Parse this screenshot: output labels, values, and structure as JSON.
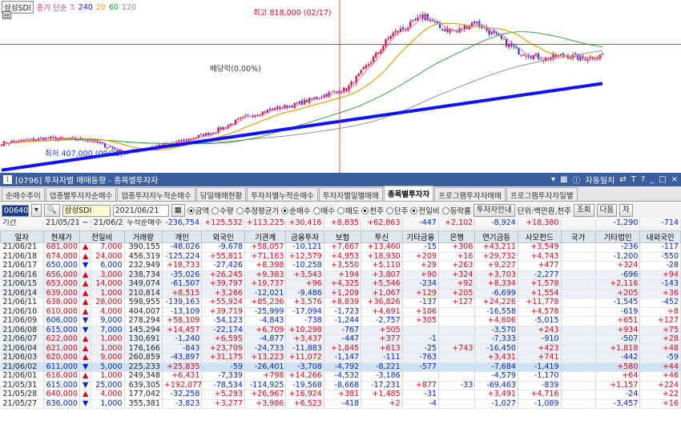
{
  "chart": {
    "legend_stock": "삼성SDI",
    "legend_ma_label": "종가 단순",
    "legend_ma": [
      {
        "period": "5",
        "color": "#ff5aaa"
      },
      {
        "period": "240",
        "color": "#1010ff"
      },
      {
        "period": "20",
        "color": "#e1a000"
      },
      {
        "period": "60",
        "color": "#1b9f2b"
      },
      {
        "period": "120",
        "color": "#888888"
      }
    ],
    "high_label": "최고 818,000 (02/17)",
    "low_label": "최저 407,000 (09/25)",
    "div_label": "배당락(0.00%)",
    "colors": {
      "up": "#e4002a",
      "down": "#1a3cf0",
      "ma5": "#ff5aaa",
      "ma20": "#e1a000",
      "ma60": "#1b9f2b",
      "ma120": "#888888",
      "ma240": "#1010ff"
    }
  },
  "window": {
    "title": "[0796] 투자자별 매매동향 - 종목별투자자",
    "hint": "자동일치",
    "btns": [
      "▾",
      "?",
      "_",
      "□",
      "×"
    ]
  },
  "tabs": [
    "순매수추이",
    "업종별투자자순매수",
    "업종투자자누적순매수",
    "당일매매현황",
    "투자자별누적순매수",
    "투자자별일별매매",
    "종목별투자자",
    "프로그램투자자매매",
    "프로그램투자자일별"
  ],
  "active_tab": 6,
  "controls": {
    "code": "006400",
    "stock_name": "삼성SDI",
    "date": "2021/06/21",
    "radio1": [
      "금액",
      "수량",
      "추정평균가"
    ],
    "radio2": [
      "순매수",
      "매수",
      "매도"
    ],
    "radio3": [
      "천주",
      "단주"
    ],
    "radio4": [
      "전일비",
      "등락률"
    ],
    "info_btn": "투자자안내",
    "unit": "단위:백만원,천주",
    "btn_query": "조회",
    "btn_next": "다음",
    "btn_chart": "차"
  },
  "period_row": {
    "label": "기간",
    "from": "21/05/21",
    "to": "21/06/21",
    "cum_label": "누적순매수",
    "values": [
      "-236,754",
      "+125,532",
      "+113,225",
      "+30,416",
      "+8,835",
      "+62,863",
      "-447",
      "+2,102",
      "-8,924",
      "+18,380",
      "",
      "-1,290",
      "-714"
    ]
  },
  "columns": [
    "일자",
    "현재가",
    "전일비",
    "거래량",
    "개인",
    "외국인",
    "기관계",
    "금융투자",
    "보험",
    "투신",
    "기타금융",
    "은행",
    "연기금등",
    "사모펀드",
    "국가",
    "기타법인",
    "내외국인"
  ],
  "rows": [
    [
      "21/06/21",
      "681,000",
      "▲",
      "7,000",
      "390,155",
      "-48,026",
      "-9,678",
      "+58,057",
      "-10,121",
      "+7,667",
      "+13,460",
      "-15",
      "+306",
      "+43,211",
      "+3,549",
      "",
      "-236",
      "-117"
    ],
    [
      "21/06/18",
      "674,000",
      "▲",
      "24,000",
      "456,319",
      "-125,224",
      "+55,811",
      "+71,163",
      "+12,579",
      "+4,953",
      "+18,930",
      "+209",
      "+16",
      "+29,732",
      "+4,743",
      "",
      "-1,200",
      "-550"
    ],
    [
      "21/06/17",
      "650,000",
      "▼",
      "6,000",
      "232,949",
      "+18,733",
      "-27,426",
      "+8,398",
      "-10,258",
      "+3,550",
      "+5,110",
      "+29",
      "+263",
      "+9,227",
      "+477",
      "",
      "+324",
      "-28"
    ],
    [
      "21/06/16",
      "656,000",
      "▲",
      "3,000",
      "238,734",
      "-35,026",
      "+26,245",
      "+9,383",
      "+3,543",
      "+194",
      "+3,807",
      "+90",
      "+324",
      "+3,703",
      "-2,277",
      "",
      "-696",
      "+94"
    ],
    [
      "21/06/15",
      "653,000",
      "▲",
      "14,000",
      "349,074",
      "-61,507",
      "+39,797",
      "+19,737",
      "+96",
      "+4,325",
      "+5,546",
      "-234",
      "+92",
      "+8,334",
      "+1,578",
      "",
      "+2,116",
      "-143"
    ],
    [
      "21/06/14",
      "639,000",
      "▲",
      "1,000",
      "210,814",
      "+8,515",
      "+3,266",
      "-12,021",
      "-9,486",
      "+1,209",
      "+1,067",
      "+129",
      "+205",
      "-6,699",
      "+1,554",
      "",
      "+205",
      "+36"
    ],
    [
      "21/06/11",
      "638,000",
      "▲",
      "28,000",
      "598,955",
      "-139,163",
      "+55,924",
      "+85,236",
      "+3,576",
      "+8,839",
      "+36,826",
      "-137",
      "+127",
      "+24,226",
      "+11,778",
      "",
      "-1,545",
      "-452"
    ],
    [
      "21/06/10",
      "610,000",
      "▲",
      "4,000",
      "404,007",
      "-13,109",
      "+39,719",
      "-25,999",
      "-17,094",
      "-1,723",
      "+4,691",
      "+106",
      "",
      "-16,558",
      "+4,578",
      "",
      "-619",
      "+8"
    ],
    [
      "21/06/09",
      "606,000",
      "▼",
      "9,000",
      "278,294",
      "+58,109",
      "-54,123",
      "-4,843",
      "-738",
      "-1,244",
      "-2,757",
      "+305",
      "",
      "+4,606",
      "-5,015",
      "",
      "+651",
      "+127"
    ],
    [
      "21/06/08",
      "615,000",
      "▼",
      "7,000",
      "145,294",
      "+14,457",
      "-22,174",
      "+6,709",
      "+10,298",
      "-767",
      "+505",
      "",
      "",
      "-3,570",
      "+243",
      "",
      "+934",
      "+75"
    ],
    [
      "21/06/07",
      "622,000",
      "▲",
      "1,000",
      "130,691",
      "-1,240",
      "+6,595",
      "-4,877",
      "+3,437",
      "-447",
      "+377",
      "-1",
      "",
      "-7,333",
      "-910",
      "",
      "-507",
      "+28"
    ],
    [
      "21/06/04",
      "621,000",
      "▲",
      "1,000",
      "176,166",
      "-843",
      "+23,709",
      "-24,733",
      "-11,883",
      "+1,845",
      "+613",
      "-25",
      "+743",
      "-16,450",
      "+423",
      "",
      "+1,818",
      "+48"
    ],
    [
      "21/06/03",
      "620,000",
      "▲",
      "9,000",
      "260,859",
      "-43,897",
      "+31,175",
      "+13,223",
      "+11,072",
      "-1,147",
      "-111",
      "-763",
      "",
      "+3,431",
      "+741",
      "",
      "-442",
      "-59"
    ],
    [
      "21/06/02",
      "611,000",
      "▼",
      "5,000",
      "225,233",
      "+25,835",
      "-59",
      "-26,401",
      "-3,708",
      "-4,792",
      "-8,221",
      "-577",
      "",
      "-7,684",
      "-1,419",
      "",
      "+580",
      "+44"
    ],
    [
      "21/06/01",
      "616,000",
      "▲",
      "1,000",
      "249,348",
      "+6,431",
      "-7,339",
      "+798",
      "+14,266",
      "-4,532",
      "-3,186",
      "",
      "",
      "-4,579",
      "-1,170",
      "",
      "+64",
      "+46"
    ],
    [
      "21/05/31",
      "615,000",
      "▼",
      "25,000",
      "639,305",
      "+192,077",
      "-78,534",
      "-114,925",
      "-19,568",
      "-8,668",
      "-17,231",
      "+877",
      "-33",
      "-69,463",
      "-839",
      "",
      "+1,157",
      "+224"
    ],
    [
      "21/05/28",
      "640,000",
      "▲",
      "4,000",
      "177,042",
      "-32,258",
      "+5,293",
      "+26,967",
      "+16,924",
      "+381",
      "+1,485",
      "-31",
      "",
      "+3,491",
      "+4,716",
      "",
      "-24",
      "+22"
    ],
    [
      "21/05/27",
      "636,000",
      "▼",
      "1,000",
      "355,381",
      "-3,823",
      "+3,277",
      "+3,986",
      "+6,523",
      "-418",
      "+2",
      "-4",
      "",
      "-1,027",
      "-1,089",
      "",
      "-3,457",
      "+16"
    ]
  ]
}
